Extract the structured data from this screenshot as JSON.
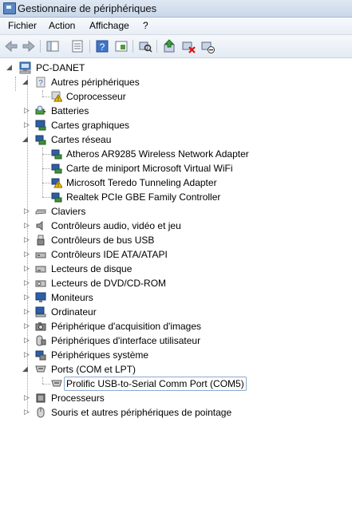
{
  "window": {
    "title": "Gestionnaire de périphériques"
  },
  "menu": [
    "Fichier",
    "Action",
    "Affichage",
    "?"
  ],
  "toolbar": [
    "back-icon",
    "forward-icon",
    "properties-pane-icon",
    "list-icon",
    "help-icon",
    "console-icon",
    "scan-hardware-icon",
    "update-driver-icon",
    "uninstall-icon",
    "disable-icon"
  ],
  "tree": {
    "root": "PC-DANET",
    "nodes": [
      {
        "label": "Autres périphériques",
        "expanded": true,
        "icon": "unknown-device-icon",
        "children": [
          "Coprocesseur"
        ]
      },
      {
        "label": "Batteries",
        "icon": "battery-icon"
      },
      {
        "label": "Cartes graphiques",
        "icon": "display-adapter-icon"
      },
      {
        "label": "Cartes réseau",
        "expanded": true,
        "icon": "network-adapter-icon",
        "children": [
          "Atheros AR9285 Wireless Network Adapter",
          "Carte de miniport Microsoft Virtual WiFi",
          "Microsoft Teredo Tunneling Adapter",
          "Realtek PCIe GBE Family Controller"
        ]
      },
      {
        "label": "Claviers",
        "icon": "keyboard-icon"
      },
      {
        "label": "Contrôleurs audio, vidéo et jeu",
        "icon": "speaker-icon"
      },
      {
        "label": "Contrôleurs de bus USB",
        "icon": "usb-icon"
      },
      {
        "label": "Contrôleurs IDE ATA/ATAPI",
        "icon": "ide-controller-icon"
      },
      {
        "label": "Lecteurs de disque",
        "icon": "disk-drive-icon"
      },
      {
        "label": "Lecteurs de DVD/CD-ROM",
        "icon": "cdrom-icon"
      },
      {
        "label": "Moniteurs",
        "icon": "monitor-icon"
      },
      {
        "label": "Ordinateur",
        "icon": "computer-icon"
      },
      {
        "label": "Périphérique d'acquisition d'images",
        "icon": "camera-icon"
      },
      {
        "label": "Périphériques d'interface utilisateur",
        "icon": "hid-icon"
      },
      {
        "label": "Périphériques système",
        "icon": "system-device-icon"
      },
      {
        "label": "Ports (COM et LPT)",
        "expanded": true,
        "icon": "port-icon",
        "children": [
          "Prolific USB-to-Serial Comm Port (COM5)"
        ]
      },
      {
        "label": "Processeurs",
        "icon": "processor-icon"
      },
      {
        "label": "Souris et autres périphériques de pointage",
        "icon": "mouse-icon"
      }
    ]
  },
  "selected": "Prolific USB-to-Serial Comm Port (COM5)",
  "colors": {
    "accent": "#2e6bc2",
    "warning": "#f2c200"
  }
}
